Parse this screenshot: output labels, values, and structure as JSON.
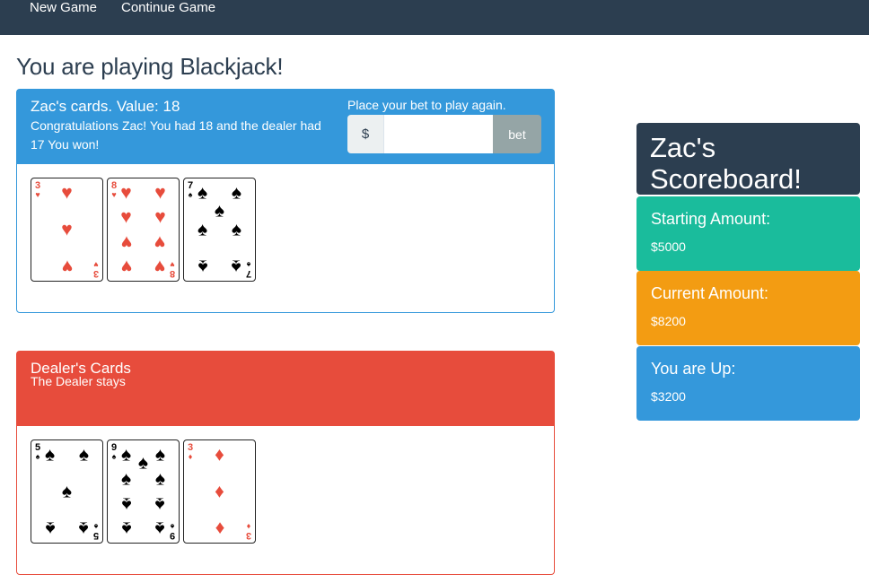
{
  "nav": {
    "new_game": "New Game",
    "continue_game": "Continue Game"
  },
  "page_title": "You are playing Blackjack!",
  "player": {
    "title": "Zac's cards. Value: 18",
    "message": "Congratulations Zac! You had 18 and the dealer had 17 You won!",
    "bet_label": "Place your bet to play again.",
    "bet_currency": "$",
    "bet_input_value": "",
    "bet_button": "bet",
    "cards": [
      {
        "rank": "3",
        "suit": "hearts",
        "symbol": "♥",
        "color": "red"
      },
      {
        "rank": "8",
        "suit": "hearts",
        "symbol": "♥",
        "color": "red"
      },
      {
        "rank": "7",
        "suit": "spades",
        "symbol": "♠",
        "color": "black"
      }
    ]
  },
  "dealer": {
    "title": "Dealer's Cards",
    "message": "The Dealer stays",
    "cards": [
      {
        "rank": "5",
        "suit": "spades",
        "symbol": "♠",
        "color": "black"
      },
      {
        "rank": "9",
        "suit": "spades",
        "symbol": "♠",
        "color": "black"
      },
      {
        "rank": "3",
        "suit": "diamonds",
        "symbol": "♦",
        "color": "red"
      }
    ]
  },
  "scoreboard": {
    "title": "Zac's Scoreboard!",
    "starting_label": "Starting Amount:",
    "starting_value": "$5000",
    "current_label": "Current Amount:",
    "current_value": "$8200",
    "up_label": "You are Up:",
    "up_value": "$3200"
  },
  "colors": {
    "navbar": "#2c3e50",
    "player_panel": "#3498db",
    "dealer_panel": "#e74c3c",
    "starting": "#1abc9c",
    "current": "#f39c12",
    "up": "#3498db"
  }
}
